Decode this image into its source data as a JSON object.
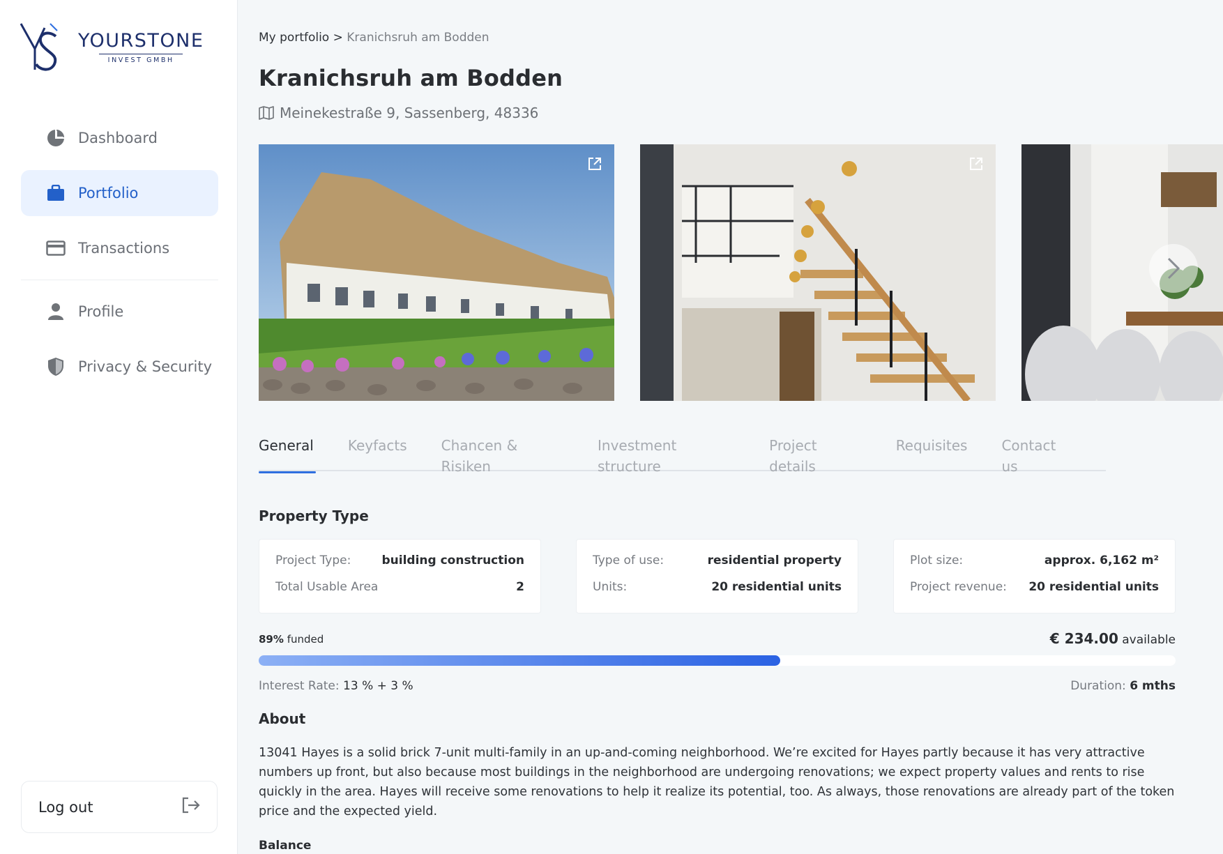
{
  "brand": {
    "name": "YOURSTONE",
    "sub": "INVEST GMBH",
    "color": "#1d2f6b"
  },
  "sidebar": {
    "items": [
      {
        "label": "Dashboard",
        "icon": "pie-chart-icon",
        "active": false
      },
      {
        "label": "Portfolio",
        "icon": "briefcase-icon",
        "active": true
      },
      {
        "label": "Transactions",
        "icon": "credit-card-icon",
        "active": false
      },
      {
        "label": "Profile",
        "icon": "person-icon",
        "active": false
      },
      {
        "label": "Privacy & Security",
        "icon": "shield-icon",
        "active": false
      }
    ],
    "logout": {
      "label": "Log out",
      "icon": "logout-icon"
    }
  },
  "breadcrumb": {
    "parent": "My portfolio",
    "separator": ">",
    "current": "Kranichsruh am Bodden"
  },
  "property": {
    "title": "Kranichsruh am Bodden",
    "address": "Meinekestraße 9, Sassenberg, 48336"
  },
  "gallery": {
    "photos": [
      "exterior-thatched-houses",
      "interior-staircase",
      "interior-dining"
    ],
    "next_icon": "chevron-right-icon",
    "open_icon": "external-link-icon"
  },
  "tabs": [
    "General",
    "Keyfacts",
    "Chancen & Risiken",
    "Investment structure",
    "Project details",
    "Requisites",
    "Contact us"
  ],
  "active_tab": "General",
  "property_type": {
    "heading": "Property Type",
    "cards": [
      {
        "rows": [
          {
            "k": "Project Type:",
            "v": "building construction"
          },
          {
            "k": "Total Usable Area",
            "v": "2"
          }
        ]
      },
      {
        "rows": [
          {
            "k": "Type of use:",
            "v": "residential property"
          },
          {
            "k": "Units:",
            "v": "20 residential units"
          }
        ]
      },
      {
        "rows": [
          {
            "k": "Plot size:",
            "v": "approx. 6,162 m²"
          },
          {
            "k": "Project revenue:",
            "v": "20 residential units"
          }
        ]
      }
    ]
  },
  "funding": {
    "percent": 89,
    "percent_label": "89%",
    "funded_label": "funded",
    "amount": "€ 234.00",
    "available_label": "available",
    "bar_fraction": 0.569,
    "accent": "#2b62e3"
  },
  "terms": {
    "interest_label": "Interest Rate:",
    "interest_value": "13 % + 3 %",
    "duration_label": "Duration:",
    "duration_value": "6 mths"
  },
  "about": {
    "heading": "About",
    "text": "13041 Hayes is a solid brick 7-unit multi-family in an up-and-coming neighborhood. We’re excited for Hayes partly because it has very attractive numbers up front, but also because most buildings in the neighborhood are undergoing renovations; we expect property values and rents to rise quickly in the area. Hayes will receive some renovations to help it realize its potential, too. As always, those renovations are already part of the token price and the expected yield."
  },
  "balance": {
    "heading": "Balance"
  }
}
